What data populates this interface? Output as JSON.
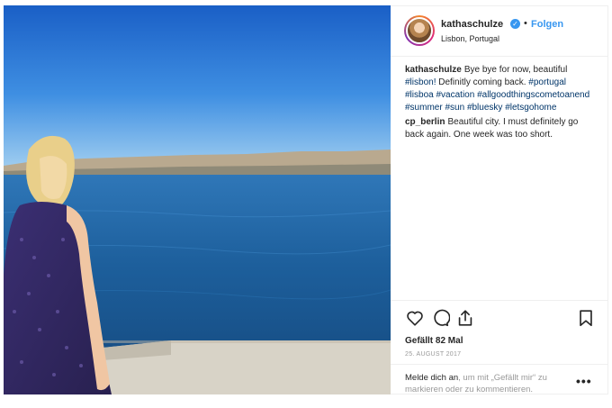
{
  "post": {
    "username": "kathaschulze",
    "verified_icon": "verified-badge-icon",
    "separator": "•",
    "follow_label": "Folgen",
    "location": "Lisbon, Portugal",
    "photo_description_icon": "photo-woman-lisbon-sea"
  },
  "comments": [
    {
      "author": "kathaschulze",
      "text_before": "Bye bye for now, beautiful",
      "tags": [
        "#lisbon!"
      ],
      "text_mid": "Definitly coming back.",
      "tags2": [
        "#portugal",
        "#lisboa",
        "#vacation",
        "#allgoodthingscometoanend",
        "#summer",
        "#sun",
        "#bluesky",
        "#letsgohome"
      ]
    },
    {
      "author": "cp_berlin",
      "text": "Beautiful city. I must definitely go back again. One week was too short."
    }
  ],
  "actions": {
    "like_icon": "heart-icon",
    "comment_icon": "comment-icon",
    "share_icon": "share-icon",
    "save_icon": "bookmark-icon",
    "likes": "Gefällt 82 Mal",
    "date": "25. AUGUST 2017"
  },
  "login": {
    "link": "Melde dich an",
    "rest": ", um mit „Gefällt mir“ zu markieren oder zu kommentieren.",
    "more_label": "•••"
  },
  "colors": {
    "link_blue": "#3897f0",
    "hashtag": "#003569",
    "muted": "#999999"
  }
}
